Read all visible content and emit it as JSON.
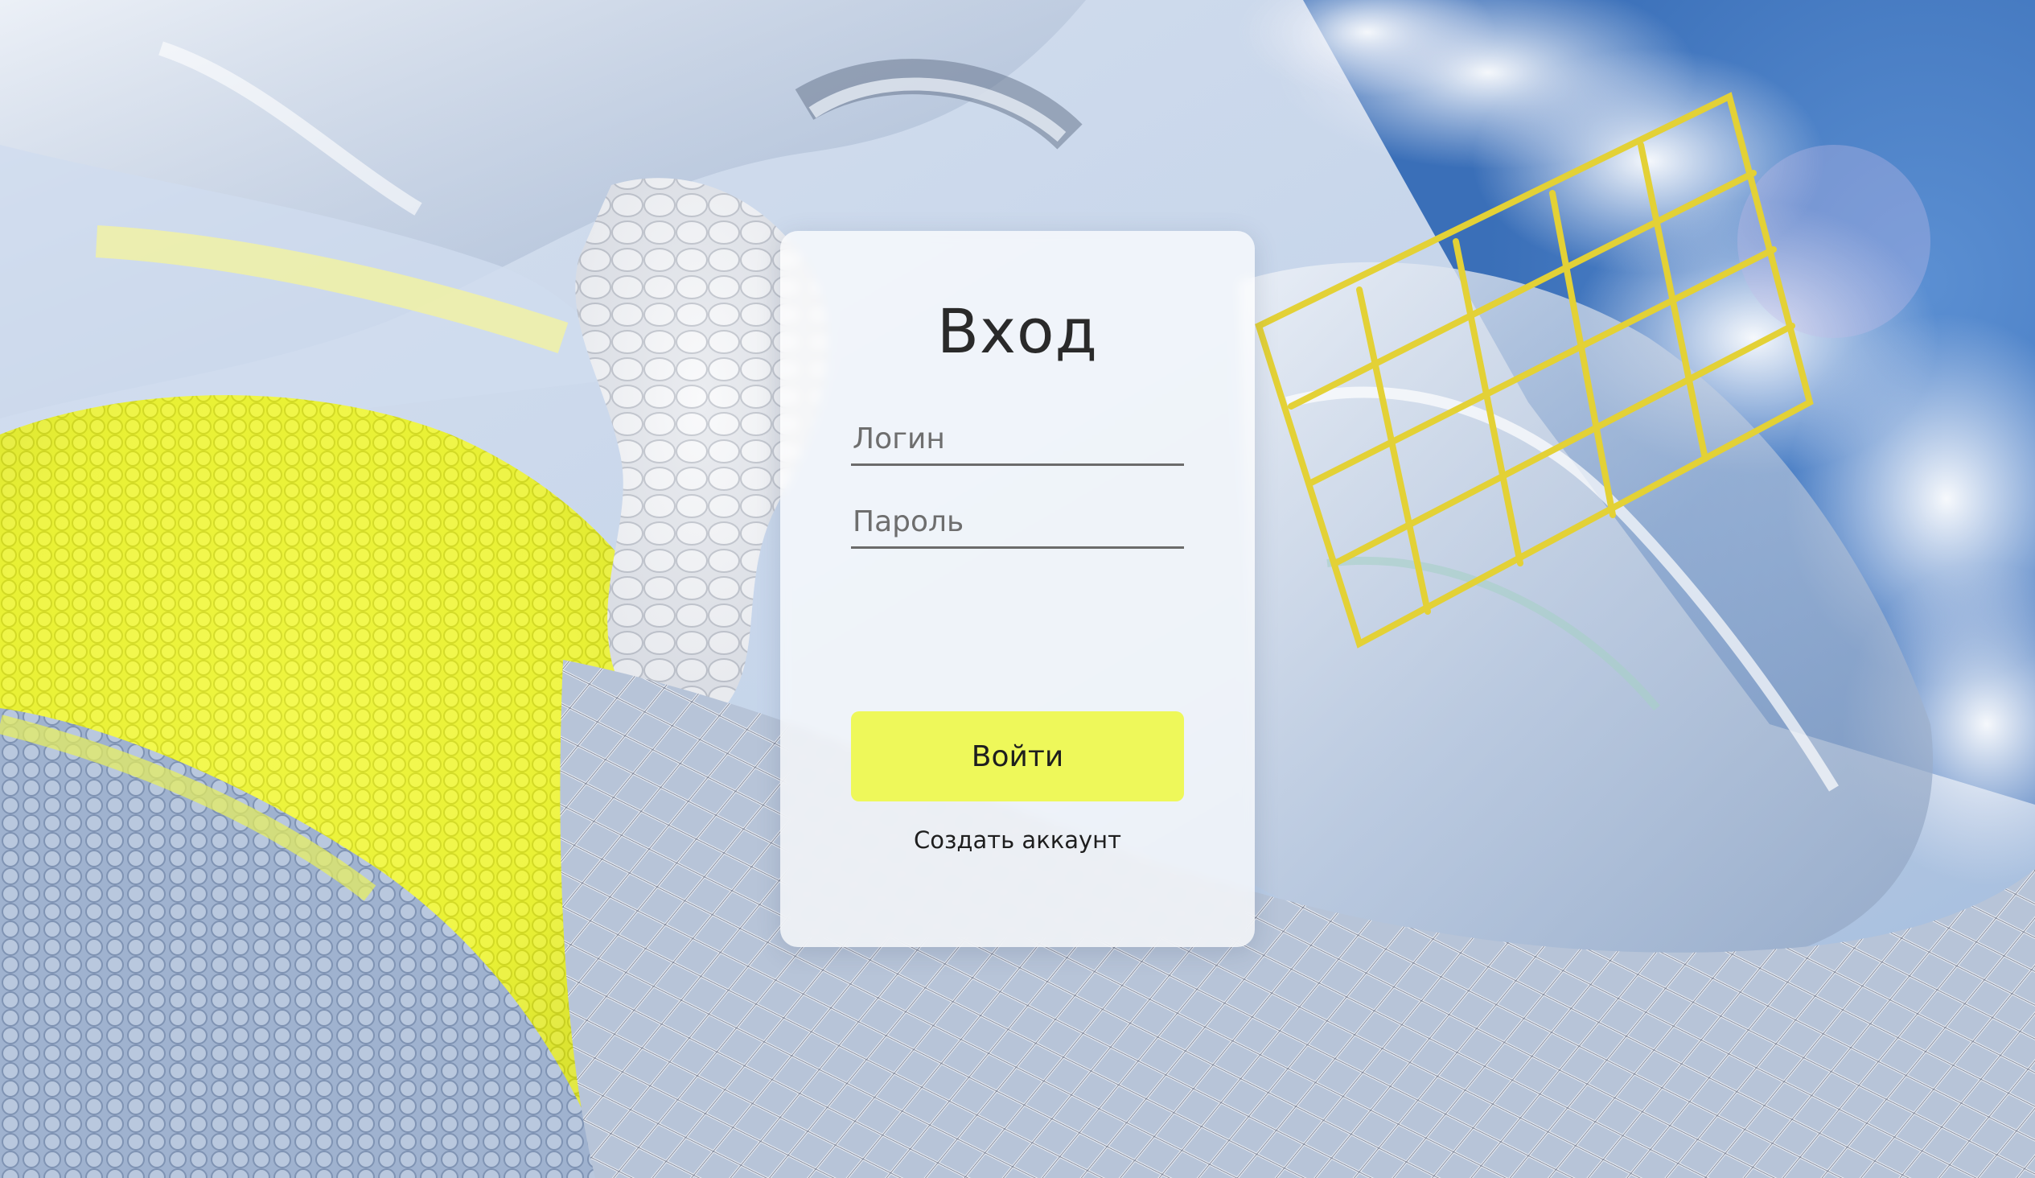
{
  "login_form": {
    "title": "Вход",
    "login_placeholder": "Логин",
    "password_placeholder": "Пароль",
    "submit_label": "Войти",
    "create_account_label": "Создать аккаунт"
  },
  "colors": {
    "accent": "#eef85a",
    "card_background": "#ffffff",
    "text": "#2a2a2a"
  }
}
